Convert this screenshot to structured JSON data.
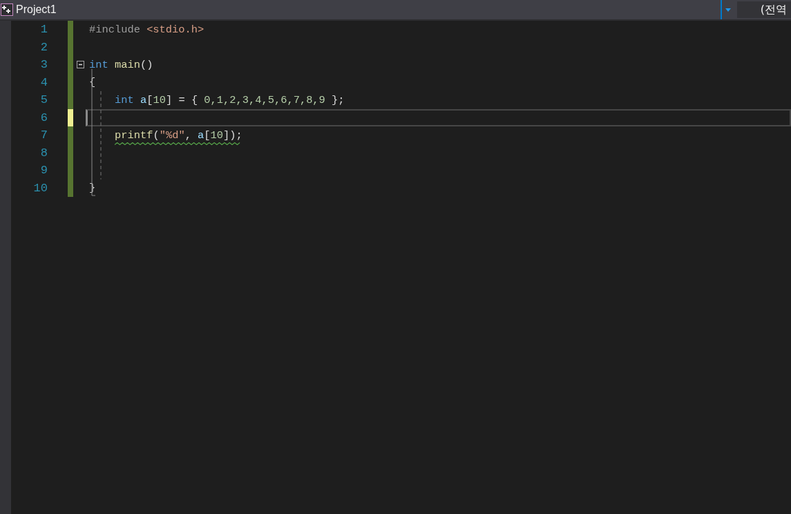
{
  "title_bar": {
    "project": "Project1",
    "scope": "(전역"
  },
  "lines": [
    {
      "number": "1",
      "indented": false,
      "modified": false,
      "current": false,
      "warning": false,
      "tokens": [
        {
          "text": "#include",
          "kind": "preproc",
          "spaced": false
        },
        {
          "text": "<stdio.h>",
          "kind": "string",
          "spaced": true
        }
      ]
    },
    {
      "number": "2",
      "modified": false,
      "current": false,
      "warning": false
    },
    {
      "number": "3",
      "indented": false,
      "modified": false,
      "current": false,
      "warning": false,
      "expanded": true,
      "tokens": [
        {
          "text": "int",
          "kind": "keyword",
          "spaced": false
        },
        {
          "text": "main",
          "kind": "function",
          "spaced": true
        },
        {
          "text": "()",
          "kind": "plain",
          "spaced": false
        }
      ]
    },
    {
      "number": "4",
      "indented": false,
      "modified": false,
      "current": false,
      "warning": false,
      "tokens": [
        {
          "text": "{",
          "kind": "plain",
          "spaced": false
        }
      ]
    },
    {
      "number": "5",
      "indented": true,
      "modified": false,
      "current": false,
      "warning": false,
      "tokens": [
        {
          "text": "int",
          "kind": "keyword",
          "spaced": false
        },
        {
          "text": "a",
          "kind": "variable",
          "spaced": true
        },
        {
          "text": "[",
          "kind": "plain",
          "spaced": false
        },
        {
          "text": "10",
          "kind": "number",
          "spaced": false
        },
        {
          "text": "] = {",
          "kind": "plain",
          "spaced": false
        },
        {
          "text": "0,1,2,3,4,5,6,7,8,9",
          "kind": "number",
          "spaced": true
        },
        {
          "text": "};",
          "kind": "plain",
          "spaced": true
        }
      ]
    },
    {
      "number": "6",
      "indented": true,
      "modified": true,
      "current": true,
      "warning": false
    },
    {
      "number": "7",
      "indented": true,
      "modified": false,
      "current": false,
      "warning": true,
      "tokens": [
        {
          "text": "printf",
          "kind": "function",
          "spaced": false
        },
        {
          "text": "(",
          "kind": "plain",
          "spaced": false
        },
        {
          "text": "\"%d\"",
          "kind": "string",
          "spaced": false
        },
        {
          "text": ",",
          "kind": "plain",
          "spaced": false
        },
        {
          "text": "a",
          "kind": "variable",
          "spaced": true
        },
        {
          "text": "[",
          "kind": "plain",
          "spaced": false
        },
        {
          "text": "10",
          "kind": "number",
          "spaced": false
        },
        {
          "text": "]);",
          "kind": "plain",
          "spaced": false
        }
      ]
    },
    {
      "number": "8",
      "modified": false,
      "current": false,
      "warning": false
    },
    {
      "number": "9",
      "modified": false,
      "current": false,
      "warning": false
    },
    {
      "number": "10",
      "indented": false,
      "modified": false,
      "current": false,
      "warning": false,
      "tokens": [
        {
          "text": "}",
          "kind": "plain",
          "spaced": false
        }
      ]
    }
  ]
}
